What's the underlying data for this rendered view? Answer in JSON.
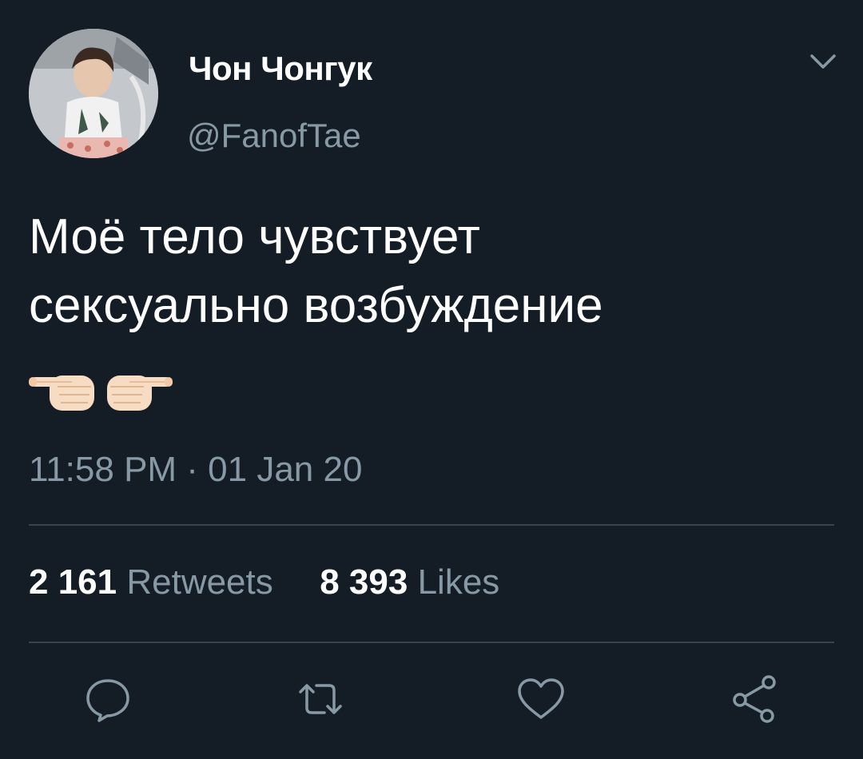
{
  "tweet": {
    "author": {
      "display_name": "Чон Чонгук",
      "handle": "@FanofTae"
    },
    "text_lines": [
      "Моё тело чувствует",
      "сексуально возбуждение"
    ],
    "emoji": [
      "pointing-left-hand",
      "pointing-right-hand"
    ],
    "timestamp": "11:58 PM · 01 Jan 20",
    "stats": {
      "retweets_count": "2 161",
      "retweets_label": "Retweets",
      "likes_count": "8 393",
      "likes_label": "Likes"
    },
    "actions": [
      "reply-icon",
      "retweet-icon",
      "like-icon",
      "share-icon"
    ]
  },
  "colors": {
    "background": "#141d26",
    "text_primary": "#ffffff",
    "text_secondary": "#8899a6",
    "divider": "#38444d"
  }
}
